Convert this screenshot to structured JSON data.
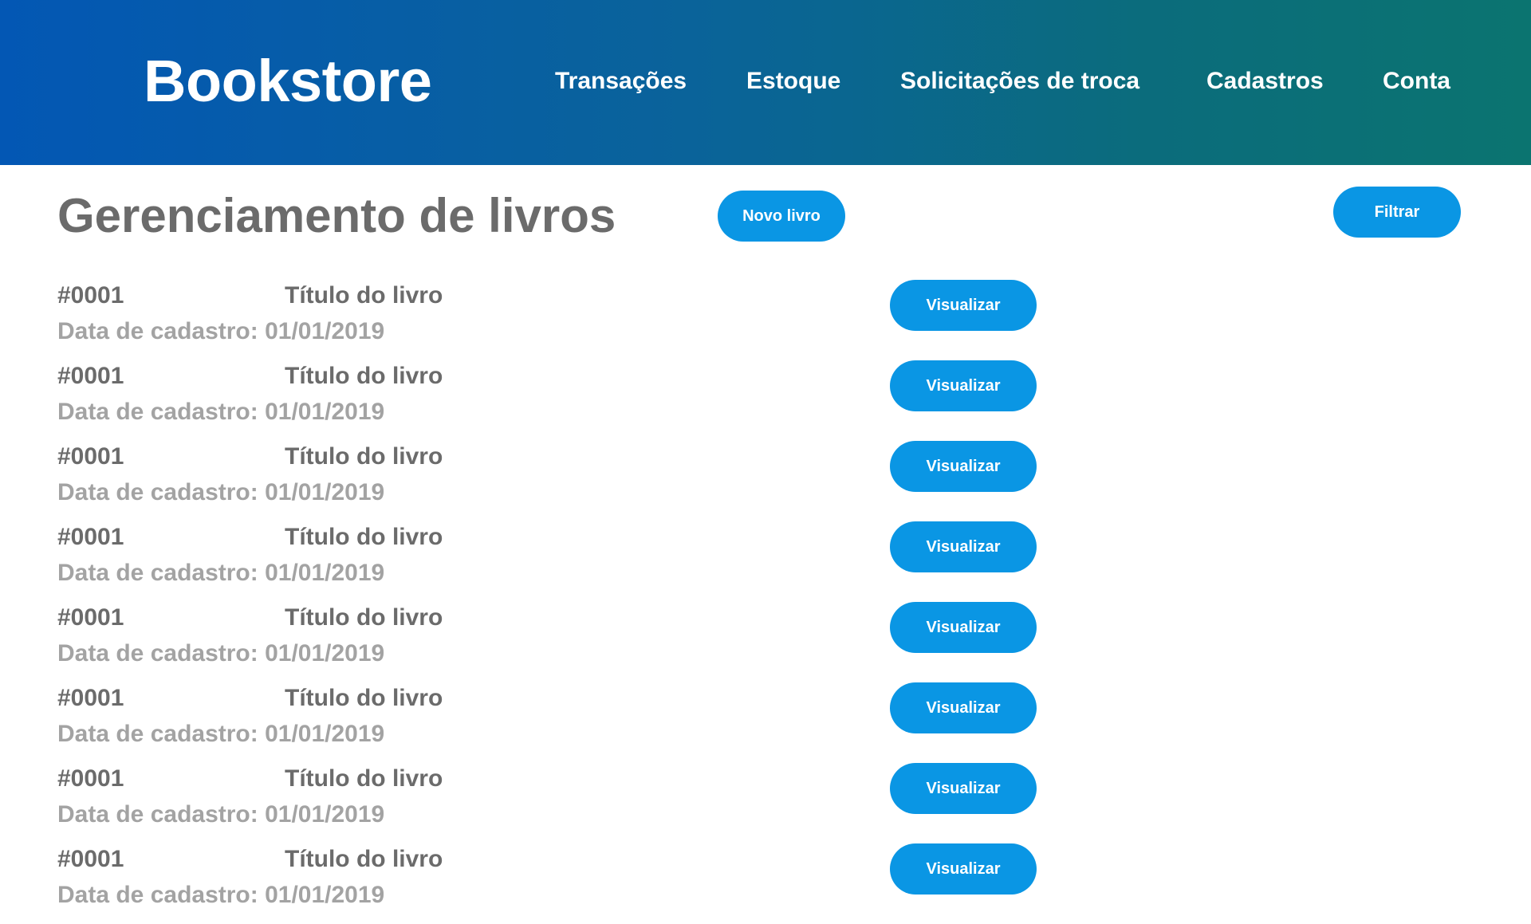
{
  "header": {
    "logo": "Bookstore",
    "nav": [
      {
        "label": "Transações",
        "name": "nav-transacoes"
      },
      {
        "label": "Estoque",
        "name": "nav-estoque"
      },
      {
        "label": "Solicitações de troca",
        "name": "nav-solicitacoes-de-troca"
      },
      {
        "label": "Cadastros",
        "name": "nav-cadastros"
      },
      {
        "label": "Conta",
        "name": "nav-conta"
      }
    ],
    "gradient_colors": [
      "#0357b4",
      "#0b7470"
    ]
  },
  "main": {
    "title": "Gerenciamento de livros",
    "new_button": "Novo livro",
    "filter_button": "Filtrar",
    "accent_color": "#0a96e4"
  },
  "books": [
    {
      "id": "#0001",
      "title": "Título do livro",
      "date_label": "Data de cadastro:",
      "date": "01/01/2019",
      "action": "Visualizar"
    },
    {
      "id": "#0001",
      "title": "Título do livro",
      "date_label": "Data de cadastro:",
      "date": "01/01/2019",
      "action": "Visualizar"
    },
    {
      "id": "#0001",
      "title": "Título do livro",
      "date_label": "Data de cadastro:",
      "date": "01/01/2019",
      "action": "Visualizar"
    },
    {
      "id": "#0001",
      "title": "Título do livro",
      "date_label": "Data de cadastro:",
      "date": "01/01/2019",
      "action": "Visualizar"
    },
    {
      "id": "#0001",
      "title": "Título do livro",
      "date_label": "Data de cadastro:",
      "date": "01/01/2019",
      "action": "Visualizar"
    },
    {
      "id": "#0001",
      "title": "Título do livro",
      "date_label": "Data de cadastro:",
      "date": "01/01/2019",
      "action": "Visualizar"
    },
    {
      "id": "#0001",
      "title": "Título do livro",
      "date_label": "Data de cadastro:",
      "date": "01/01/2019",
      "action": "Visualizar"
    },
    {
      "id": "#0001",
      "title": "Título do livro",
      "date_label": "Data de cadastro:",
      "date": "01/01/2019",
      "action": "Visualizar"
    }
  ]
}
